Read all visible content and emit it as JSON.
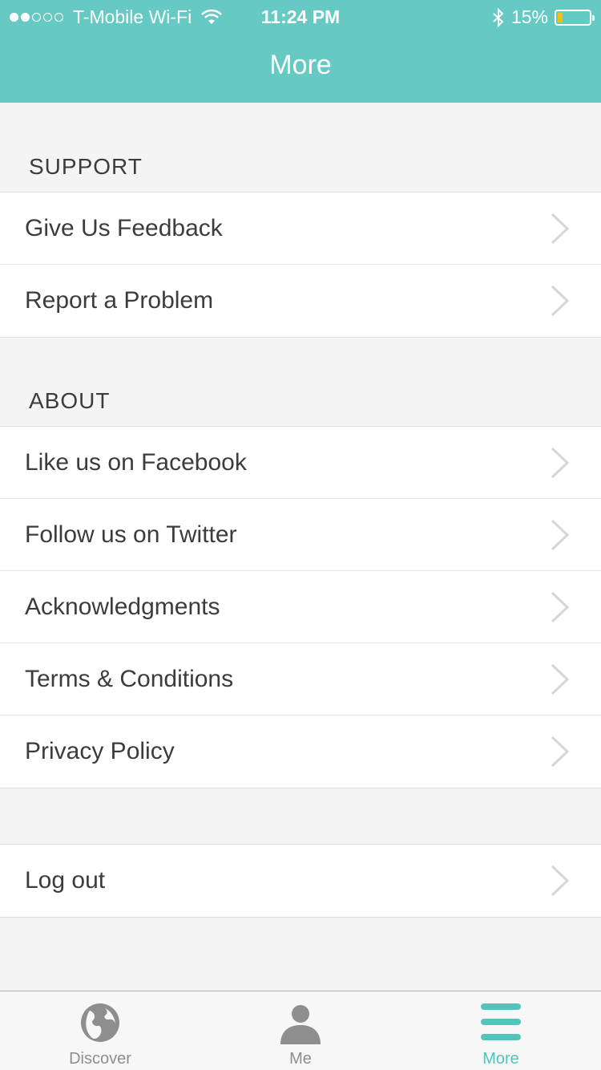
{
  "status_bar": {
    "carrier": "T-Mobile Wi-Fi",
    "time": "11:24 PM",
    "battery": "15%",
    "battery_level": 0.15
  },
  "header": {
    "title": "More"
  },
  "sections": [
    {
      "title": "SUPPORT",
      "items": [
        {
          "label": "Give Us Feedback"
        },
        {
          "label": "Report a Problem"
        }
      ]
    },
    {
      "title": "ABOUT",
      "items": [
        {
          "label": "Like us on Facebook"
        },
        {
          "label": "Follow us on Twitter"
        },
        {
          "label": "Acknowledgments"
        },
        {
          "label": "Terms & Conditions"
        },
        {
          "label": "Privacy Policy"
        }
      ]
    }
  ],
  "logout": {
    "label": "Log out"
  },
  "tabbar": {
    "tabs": [
      {
        "label": "Discover",
        "icon": "globe-icon"
      },
      {
        "label": "Me",
        "icon": "person-icon"
      },
      {
        "label": "More",
        "icon": "menu-icon",
        "active": true
      }
    ]
  },
  "colors": {
    "accent": "#66c9c3",
    "active_tab": "#52c4bb",
    "battery_fill": "#f2c10f"
  }
}
